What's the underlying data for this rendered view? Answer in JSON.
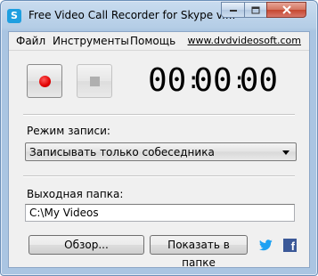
{
  "window": {
    "title": "Free Video Call Recorder for Skype v....",
    "app_icon_letter": "S"
  },
  "menu": {
    "items": [
      "Файл",
      "Инструменты",
      "Помощь"
    ],
    "site_link": "www.dvdvideosoft.com"
  },
  "recorder": {
    "timer": {
      "hours": "00",
      "minutes": "00",
      "seconds": "00"
    }
  },
  "record_mode": {
    "label": "Режим записи:",
    "selected": "Записывать только собеседника"
  },
  "output": {
    "label": "Выходная папка:",
    "path": "C:\\My Videos"
  },
  "buttons": {
    "browse": "Обзор...",
    "open_folder": "Показать в папке"
  },
  "social": {
    "facebook_letter": "f"
  },
  "colors": {
    "record_red": "#e00000",
    "twitter_blue": "#1da1f2",
    "facebook_blue": "#3b5998"
  }
}
